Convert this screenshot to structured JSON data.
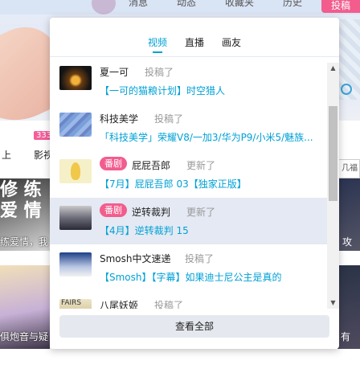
{
  "header": {
    "nav": [
      "消息",
      "动态",
      "收藏夹",
      "历史"
    ],
    "post_button": "投稿"
  },
  "background": {
    "badge": "333",
    "text_left": "上",
    "text_mid": "影视",
    "search_hint": "几福",
    "caption_left_top": "修\n练\n爱\n情",
    "caption_left": "练爱情，我",
    "caption_right": "攻",
    "caption_left_bottom": "俱炮音与疑",
    "caption_right_bottom": "有"
  },
  "tabs": [
    {
      "label": "视频",
      "active": true
    },
    {
      "label": "直播",
      "active": false
    },
    {
      "label": "画友",
      "active": false
    }
  ],
  "feed": [
    {
      "user": "夏一可",
      "tag": "",
      "action": "投稿了",
      "title": "【一可的猫粮计划】时空猎人",
      "thumb": "t1",
      "hover": false
    },
    {
      "user": "科技美学",
      "tag": "",
      "action": "投稿了",
      "title": "「科技美学」荣耀V8/一加3/华为P9/小米5/魅族...",
      "thumb": "t2",
      "hover": false
    },
    {
      "user": "屁屁吾郎",
      "tag": "番剧",
      "action": "更新了",
      "title": "【7月】屁屁吾郎 03【独家正版】",
      "thumb": "t3",
      "hover": false
    },
    {
      "user": "逆转裁判",
      "tag": "番剧",
      "action": "更新了",
      "title": "【4月】逆转裁判 15",
      "thumb": "t4",
      "hover": true
    },
    {
      "user": "Smosh中文速递",
      "tag": "",
      "action": "投稿了",
      "title": "【Smosh】【字幕】如果迪士尼公主是真的",
      "thumb": "t5",
      "hover": false
    },
    {
      "user": "八尾妖姬",
      "tag": "",
      "action": "投稿了",
      "title": "",
      "thumb": "t6",
      "hover": false
    }
  ],
  "view_all_label": "查看全部",
  "colors": {
    "accent": "#00a1d6",
    "pink": "#f25d8e",
    "hover_bg": "#e4e9f3"
  }
}
